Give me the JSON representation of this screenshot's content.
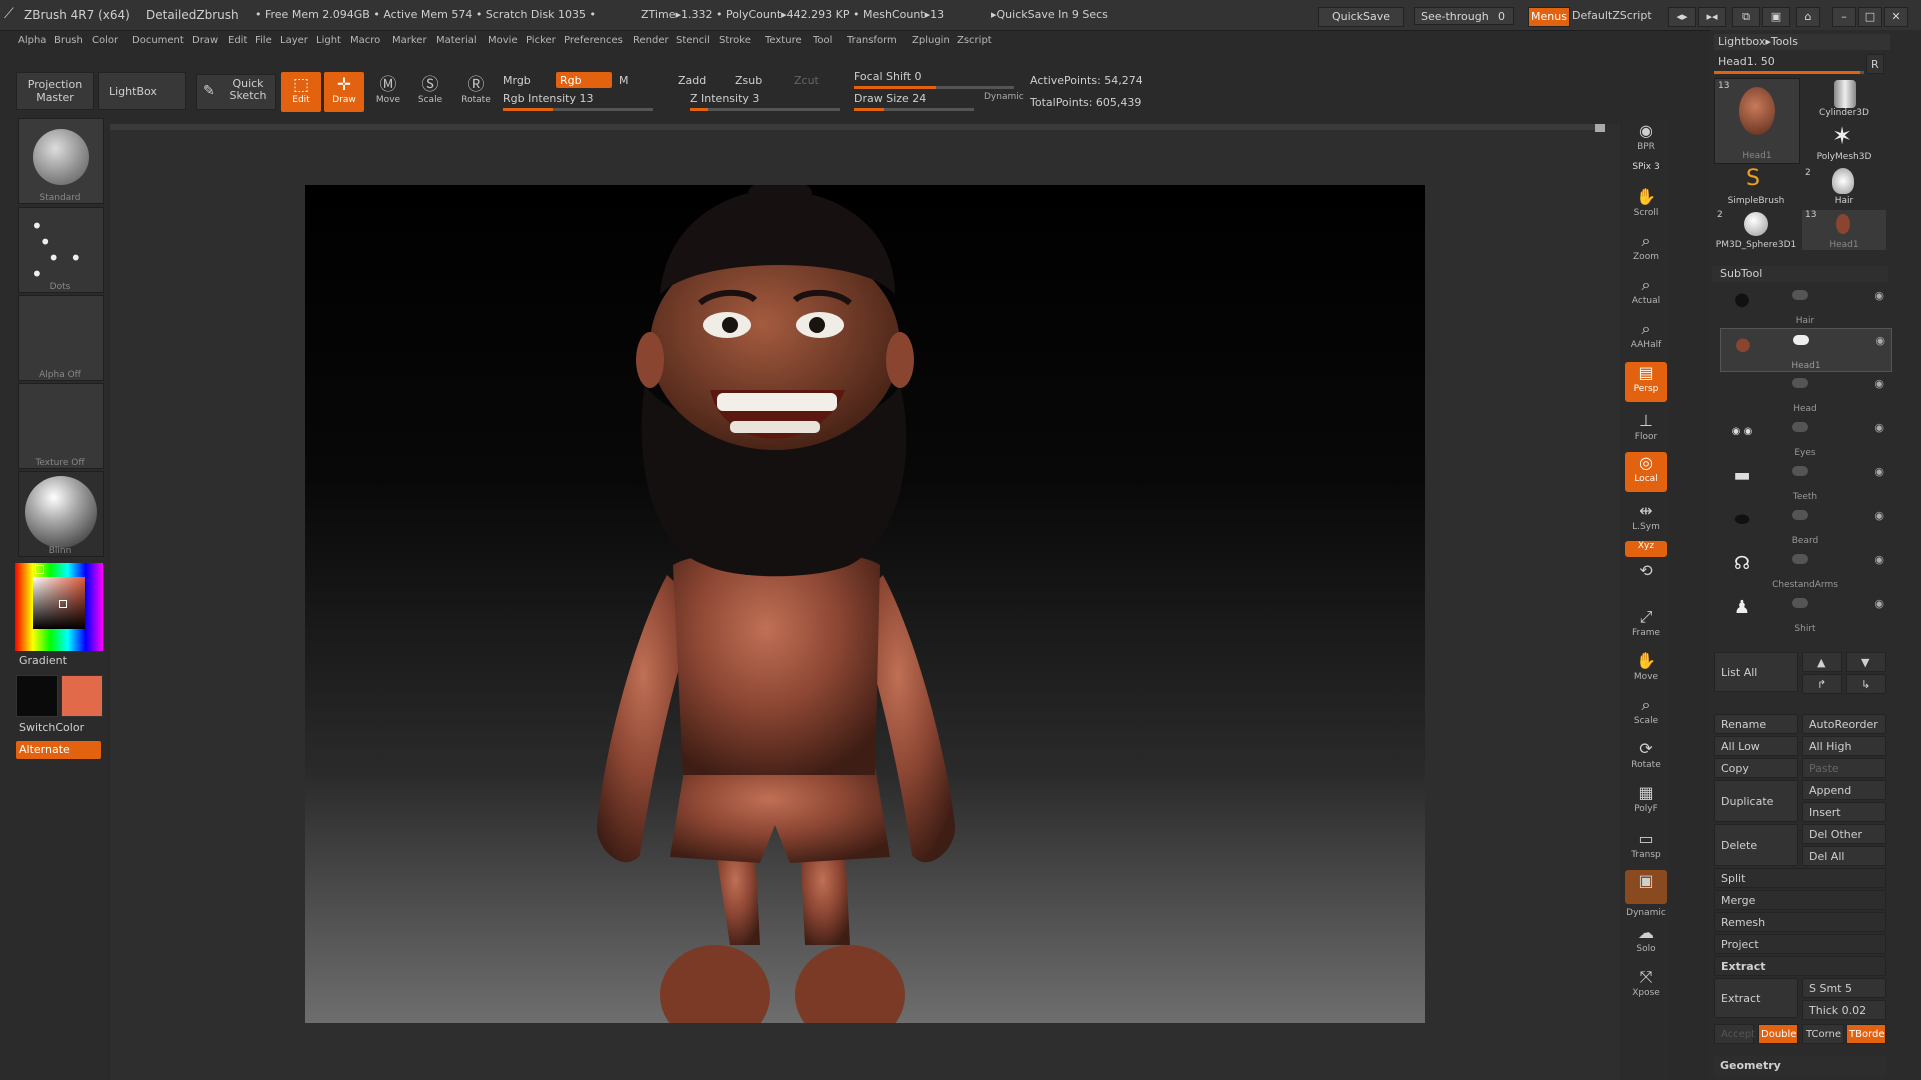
{
  "title_bar": {
    "app": "ZBrush 4R7 (x64)",
    "document": "DetailedZbrush",
    "status": "• Free Mem 2.094GB • Active Mem 574 • Scratch Disk 1035 •",
    "ztime": "ZTime▸1.332 • PolyCount▸442.293 KP • MeshCount▸13",
    "quicksave_in": "▸QuickSave In 9 Secs",
    "quicksave": "QuickSave",
    "see_through": "See-through",
    "see_through_value": "0",
    "menus": "Menus",
    "script": "DefaultZScript"
  },
  "menu_bar": [
    "Alpha",
    "Brush",
    "Color",
    "Document",
    "Draw",
    "Edit",
    "File",
    "Layer",
    "Light",
    "Macro",
    "Marker",
    "Material",
    "Movie",
    "Picker",
    "Preferences",
    "Render",
    "Stencil",
    "Stroke",
    "Texture",
    "Tool",
    "Transform",
    "Zplugin",
    "Zscript"
  ],
  "toolbar": {
    "projection_master": "Projection Master",
    "lightbox": "LightBox",
    "quick_sketch": "Quick Sketch",
    "edit": "Edit",
    "draw": "Draw",
    "move": "Move",
    "scale": "Scale",
    "rotate": "Rotate",
    "mrgb": "Mrgb",
    "rgb": "Rgb",
    "m": "M",
    "zadd": "Zadd",
    "zsub": "Zsub",
    "zcut": "Zcut",
    "rgb_intensity": "Rgb Intensity 13",
    "z_intensity": "Z Intensity 3",
    "focal_shift": "Focal Shift 0",
    "draw_size": "Draw Size 24",
    "dynamic": "Dynamic",
    "active_points": "ActivePoints: 54,274",
    "total_points": "TotalPoints: 605,439",
    "rgb_intensity_value": 13,
    "z_intensity_value": 3,
    "focal_shift_value": 0,
    "draw_size_value": 24
  },
  "left_panel": {
    "brush": "Standard",
    "stroke": "Dots",
    "alpha": "Alpha Off",
    "texture": "Texture Off",
    "material": "Blinn",
    "gradient": "Gradient",
    "switch_color": "SwitchColor",
    "alternate": "Alternate",
    "main_color": "#e06a4a",
    "secondary_color": "#0a0a0a"
  },
  "right_shelf": [
    "BPR",
    "SPix 3",
    "Scroll",
    "Zoom",
    "Actual",
    "AAHalf",
    "Persp",
    "Floor",
    "Local",
    "L.Sym",
    "Xyz",
    "Frame",
    "Move",
    "Scale",
    "Rotate",
    "PolyF",
    "Transp",
    "Dynamic",
    "Solo",
    "Xpose"
  ],
  "tool_panel": {
    "header": "Lightbox▸Tools",
    "current": "Head1. 50",
    "r": "R",
    "tools": [
      {
        "name": "Head1",
        "count": "13"
      },
      {
        "name": "Cylinder3D",
        "count": ""
      },
      {
        "name": "PolyMesh3D",
        "count": ""
      },
      {
        "name": "SimpleBrush",
        "count": ""
      },
      {
        "name": "Hair",
        "count": "2"
      },
      {
        "name": "PM3D_Sphere3D1",
        "count": "2"
      },
      {
        "name": "Head1",
        "count": "13"
      }
    ],
    "subtool_header": "SubTool",
    "subtools": [
      "Hair",
      "Head1",
      "Head",
      "Eyes",
      "Teeth",
      "Beard",
      "ChestandArms",
      "Shirt"
    ],
    "list_all": "List All",
    "buttons": {
      "rename": "Rename",
      "autoreorder": "AutoReorder",
      "all_low": "All Low",
      "all_high": "All High",
      "copy": "Copy",
      "paste": "Paste",
      "duplicate": "Duplicate",
      "append": "Append",
      "insert": "Insert",
      "delete": "Delete",
      "del_other": "Del Other",
      "del_all": "Del All",
      "split": "Split",
      "merge": "Merge",
      "remesh": "Remesh",
      "project": "Project",
      "extract_header": "Extract",
      "extract": "Extract",
      "s_smt": "S Smt 5",
      "thick": "Thick 0.02",
      "accept": "Accept",
      "double": "Double",
      "tcorne": "TCorne",
      "tborde": "TBorde",
      "geometry": "Geometry"
    }
  }
}
